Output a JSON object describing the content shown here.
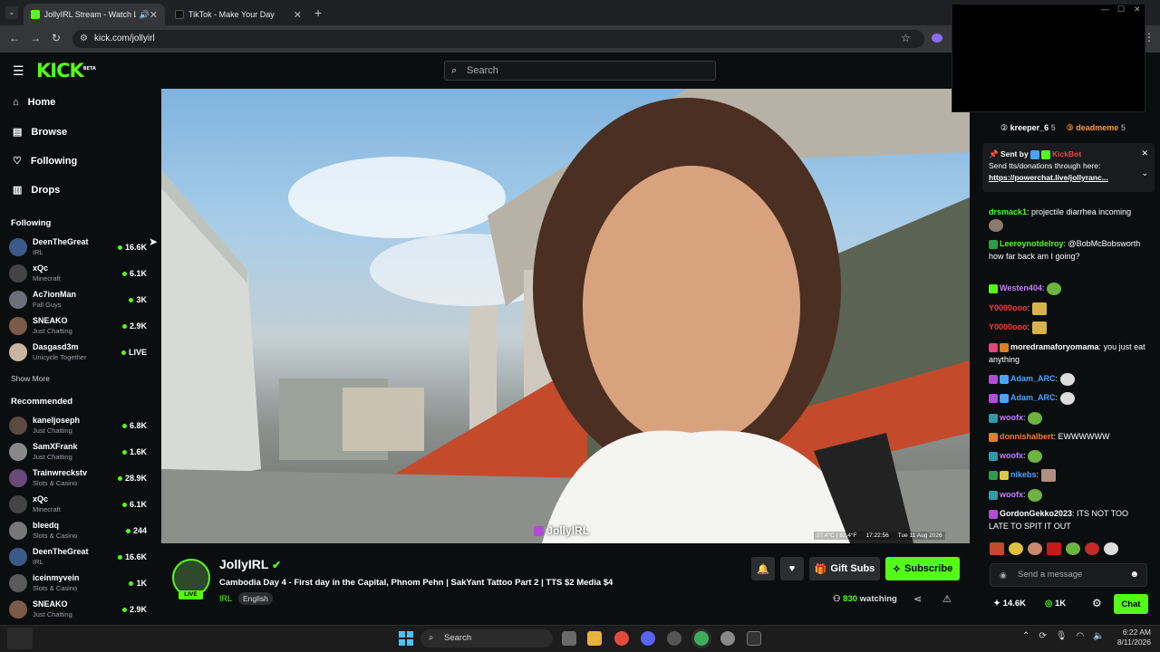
{
  "browser": {
    "tabs": [
      {
        "label": "JollyIRL Stream - Watch Live"
      },
      {
        "label": "TikTok - Make Your Day"
      }
    ],
    "url": "kick.com/jollyirl"
  },
  "header": {
    "logo": "KICK",
    "logo_sup": "BETA",
    "search_placeholder": "Search"
  },
  "sidebar": {
    "nav": [
      {
        "label": "Home"
      },
      {
        "label": "Browse"
      },
      {
        "label": "Following"
      },
      {
        "label": "Drops"
      }
    ],
    "following_title": "Following",
    "following": [
      {
        "name": "DeenTheGreat",
        "category": "IRL",
        "count": "16.6K"
      },
      {
        "name": "xQc",
        "category": "Minecraft",
        "count": "6.1K"
      },
      {
        "name": "Ac7ionMan",
        "category": "Fall Guys",
        "count": "3K"
      },
      {
        "name": "SNEAKO",
        "category": "Just Chatting",
        "count": "2.9K"
      },
      {
        "name": "Dasgasd3m",
        "category": "Unicycle Together",
        "count": "LIVE"
      }
    ],
    "show_more": "Show More",
    "recommended_title": "Recommended",
    "recommended": [
      {
        "name": "kaneljoseph",
        "category": "Just Chatting",
        "count": "6.8K"
      },
      {
        "name": "SamXFrank",
        "category": "Just Chatting",
        "count": "1.6K"
      },
      {
        "name": "Trainwreckstv",
        "category": "Slots & Casino",
        "count": "28.9K"
      },
      {
        "name": "xQc",
        "category": "Minecraft",
        "count": "6.1K"
      },
      {
        "name": "bleedq",
        "category": "Slots & Casino",
        "count": "244"
      },
      {
        "name": "DeenTheGreat",
        "category": "IRL",
        "count": "16.6K"
      },
      {
        "name": "iceinmyvein",
        "category": "Slots & Casino",
        "count": "1K"
      },
      {
        "name": "SNEAKO",
        "category": "Just Chatting",
        "count": "2.9K"
      }
    ]
  },
  "video": {
    "watermark": "JollyIRL",
    "overlay_temp": "27.4°C | 81.4°F",
    "overlay_time": "17:22:56",
    "overlay_date": "Tue 11 Aug 2026"
  },
  "stream": {
    "channel": "JollyIRL",
    "live_badge": "LIVE",
    "title": "Cambodia Day 4 - First day in the Capital, Phnom Pehn | SakYant Tattoo Part 2 | TTS $2 Media $4",
    "category": "IRL",
    "language": "English",
    "gift_subs": "Gift Subs",
    "subscribe": "Subscribe",
    "viewers": "830",
    "watching_label": "watching"
  },
  "chat": {
    "leaderboard": [
      {
        "name": "kreeper_6",
        "value": "5"
      },
      {
        "name": "deadmeme",
        "value": "5"
      }
    ],
    "pinned": {
      "sent_by_label": "Sent by",
      "sender": "KickBot",
      "text": "Send tts/donations through here:",
      "link": "https://powerchat.live/jollyranc..."
    },
    "messages": [
      {
        "user": "drsmack1",
        "text": "projectile diarrhea incoming",
        "color": "#53fc18"
      },
      {
        "user": "Leeroynotdelroy",
        "text": "@BobMcBobsworth how far back am I going?",
        "color": "#53fc18"
      },
      {
        "user": "Westen404",
        "text": "",
        "color": "#c77dff"
      },
      {
        "user": "Y0000ooo",
        "text": "",
        "color": "#ff3b3b"
      },
      {
        "user": "Y0000ooo",
        "text": "",
        "color": "#ff3b3b"
      },
      {
        "user": "moredramaforyomama",
        "text": "you just eat anything",
        "color": "#ffffff"
      },
      {
        "user": "Adam_ARC",
        "text": "",
        "color": "#4aa3ff"
      },
      {
        "user": "Adam_ARC",
        "text": "",
        "color": "#4aa3ff"
      },
      {
        "user": "woofx",
        "text": "",
        "color": "#c77dff"
      },
      {
        "user": "donnishalbert",
        "text": "EWWWWWW",
        "color": "#ff7a2b"
      },
      {
        "user": "woofx",
        "text": "",
        "color": "#c77dff"
      },
      {
        "user": "nikebs",
        "text": "",
        "color": "#4aa3ff"
      },
      {
        "user": "woofx",
        "text": "",
        "color": "#c77dff"
      },
      {
        "user": "GordonGekko2023",
        "text": "ITS NOT TOO LATE TO SPIT IT OUT",
        "color": "#ffffff"
      }
    ],
    "input_placeholder": "Send a message",
    "stat1": "14.6K",
    "stat2": "1K",
    "chat_button": "Chat"
  },
  "taskbar": {
    "search_label": "Search",
    "time": "6:22 AM",
    "date": "8/11/2026"
  },
  "colors": {
    "accent": "#53fc18",
    "background": "#0b0e0f"
  }
}
